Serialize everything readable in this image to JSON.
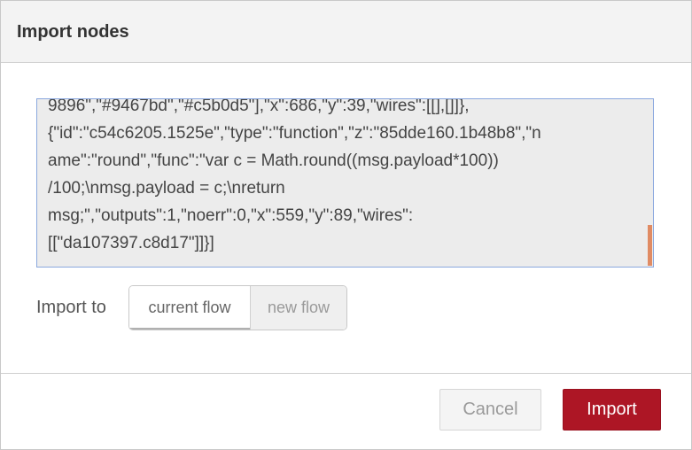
{
  "dialog": {
    "title": "Import nodes"
  },
  "code": {
    "lines": [
      "9896\",\"#9467bd\",\"#c5b0d5\"],\"x\":686,\"y\":39,\"wires\":[[],[]]},",
      "{\"id\":\"c54c6205.1525e\",\"type\":\"function\",\"z\":\"85dde160.1b48b8\",\"n",
      "ame\":\"round\",\"func\":\"var c = Math.round((msg.payload*100))",
      "/100;\\nmsg.payload = c;\\nreturn",
      "msg;\",\"outputs\":1,\"noerr\":0,\"x\":559,\"y\":89,\"wires\":",
      "[[\"da107397.c8d17\"]]}]"
    ]
  },
  "import_to": {
    "label": "Import to",
    "options": [
      "current flow",
      "new flow"
    ],
    "selected": "current flow"
  },
  "footer": {
    "cancel_label": "Cancel",
    "import_label": "Import"
  },
  "colors": {
    "accent": "#ad1625",
    "scrollbar": "#e08b63",
    "textarea_border": "#8aa8de"
  }
}
